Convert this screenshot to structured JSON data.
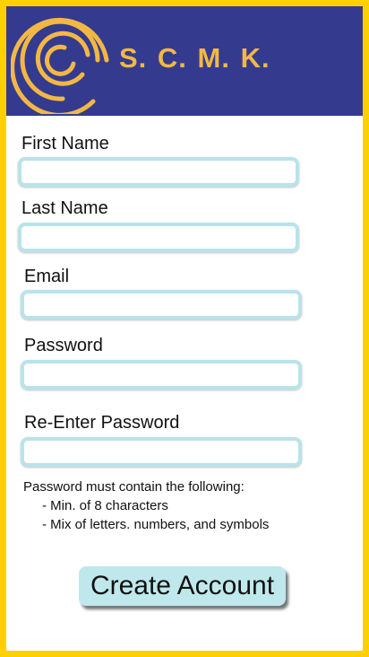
{
  "brand": {
    "name": "S. C. M. K."
  },
  "colors": {
    "frame": "#ffd000",
    "header": "#343b8f",
    "brand_text": "#f2b843",
    "field_border": "#b9e3ea",
    "button": "#bfe8ec"
  },
  "icons": {
    "logo": "spiral-logo-icon"
  },
  "form": {
    "first_name_label": "First Name",
    "first_name_value": "",
    "last_name_label": "Last Name",
    "last_name_value": "",
    "email_label": "Email",
    "email_value": "",
    "password_label": "Password",
    "password_value": "",
    "reenter_label": "Re-Enter Password",
    "reenter_value": ""
  },
  "requirements": {
    "heading": "Password must contain the following:",
    "items": [
      "- Min. of 8 characters",
      "- Mix of letters. numbers, and symbols"
    ]
  },
  "create_button_label": "Create Account"
}
